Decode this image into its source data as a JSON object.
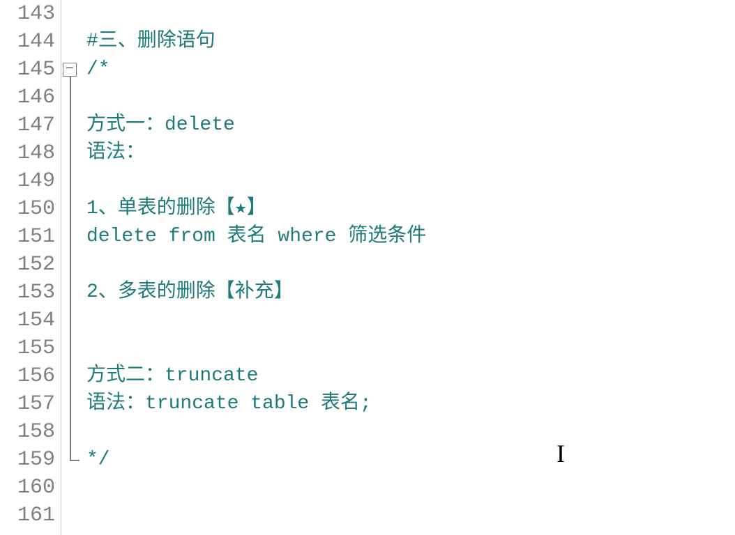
{
  "editor": {
    "startLine": 143,
    "foldMarkerLine": 145,
    "foldEndLine": 159,
    "lines": [
      {
        "num": 143,
        "text": ""
      },
      {
        "num": 144,
        "text": "#三、删除语句"
      },
      {
        "num": 145,
        "text": "/*"
      },
      {
        "num": 146,
        "text": ""
      },
      {
        "num": 147,
        "text": "方式一：delete"
      },
      {
        "num": 148,
        "text": "语法："
      },
      {
        "num": 149,
        "text": ""
      },
      {
        "num": 150,
        "text": "1、单表的删除【★】"
      },
      {
        "num": 151,
        "text": "delete from 表名 where 筛选条件"
      },
      {
        "num": 152,
        "text": ""
      },
      {
        "num": 153,
        "text": "2、多表的删除【补充】"
      },
      {
        "num": 154,
        "text": ""
      },
      {
        "num": 155,
        "text": ""
      },
      {
        "num": 156,
        "text": "方式二：truncate"
      },
      {
        "num": 157,
        "text": "语法：truncate table 表名;"
      },
      {
        "num": 158,
        "text": ""
      },
      {
        "num": 159,
        "text": "*/"
      },
      {
        "num": 160,
        "text": ""
      },
      {
        "num": 161,
        "text": ""
      }
    ],
    "foldSymbol": "−",
    "foldSymbolCollapsed": "+"
  }
}
